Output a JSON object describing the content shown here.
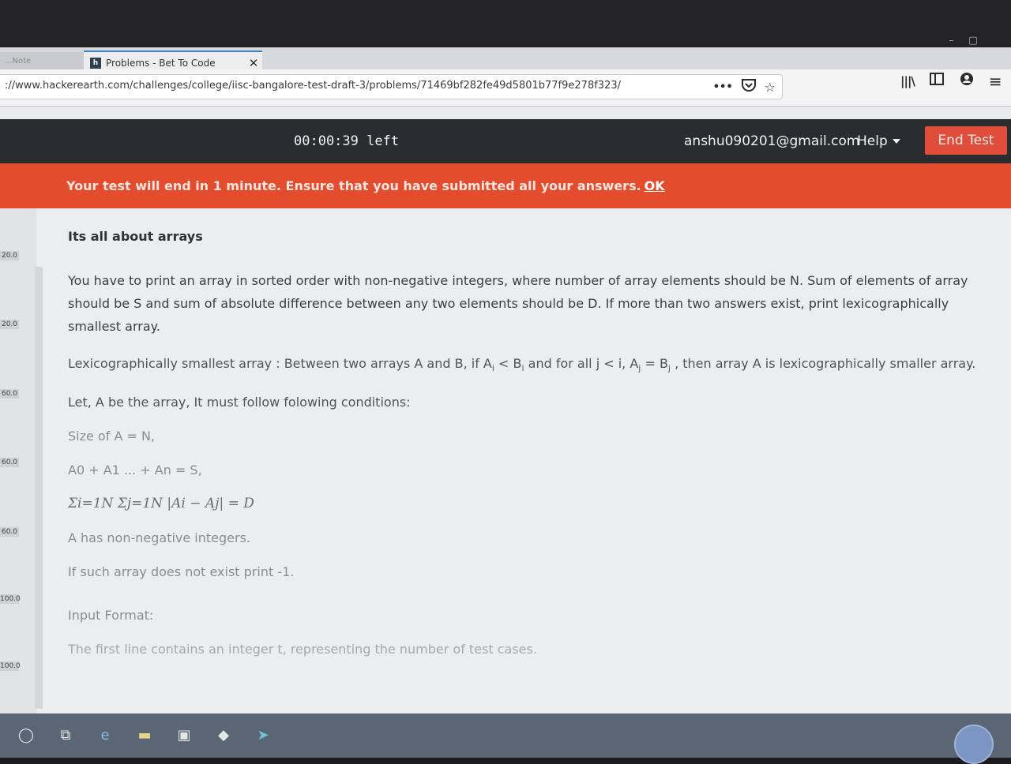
{
  "browser": {
    "prev_tab_label": "...Note",
    "tab_title": "Problems - Bet To Code",
    "tab_favicon_letter": "h",
    "url": "://www.hackerearth.com/challenges/college/iisc-bangalore-test-draft-3/problems/71469bf282fe49d5801b77f9e278f323/",
    "page_actions_label": "•••"
  },
  "header": {
    "timer": "00:00:39 left",
    "email": "anshu090201@gmail.com",
    "help_label": "Help",
    "end_test_label": "End Test"
  },
  "warning": {
    "message": "Your test will end in 1 minute. Ensure that you have submitted all your answers.",
    "ok_label": "OK"
  },
  "scores": [
    "20.0",
    "20.0",
    "60.0",
    "60.0",
    "60.0",
    "100.0",
    "100.0"
  ],
  "problem": {
    "title": "Its all about arrays",
    "statement": "You have to print an array in sorted order with non-negative integers, where number of array elements should be N. Sum of elements of array should be S and sum of absolute difference between any two elements should be D. If more than two answers exist, print lexicographically smallest array.",
    "lexi_prefix": "Lexicographically smallest array : Between two arrays A and B, if A",
    "lexi_mid1": " < B",
    "lexi_mid2": " and for all j < i, A",
    "lexi_mid3": " = B",
    "lexi_suffix": " , then array A is lexicographically smaller array.",
    "sub_i": "i",
    "sub_j": "j",
    "conditions_intro": "Let, A be the array, It must follow folowing conditions:",
    "cond_size": "Size of A = N,",
    "cond_sum": "A0 + A1 ... + An = S,",
    "cond_abs": "Σi=1N Σj=1N |Ai − Aj| = D",
    "cond_nonneg": "A has non-negative integers.",
    "cond_none": "If such array does not exist print -1.",
    "input_format_label": "Input Format:",
    "input_line1": "The first line contains an integer t, representing the number of test cases."
  },
  "taskbar": {
    "icons": [
      "cortana-icon",
      "task-view-icon",
      "edge-icon",
      "file-explorer-icon",
      "store-icon",
      "dropbox-icon",
      "app-icon"
    ]
  }
}
